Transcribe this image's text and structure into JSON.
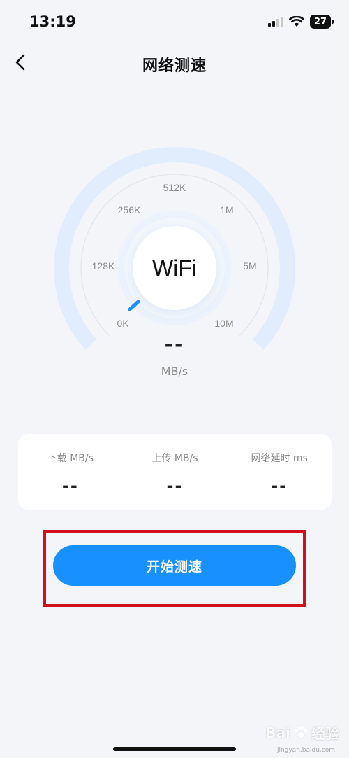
{
  "status_bar": {
    "time": "13:19",
    "battery": "27",
    "icons": [
      "cellular-signal-icon",
      "wifi-icon",
      "battery-icon"
    ]
  },
  "nav": {
    "title": "网络测速",
    "back_icon": "chevron-left-icon"
  },
  "gauge": {
    "center_label": "WiFi",
    "ticks": [
      "0K",
      "128K",
      "256K",
      "512K",
      "1M",
      "5M",
      "10M"
    ],
    "speed_value": "--",
    "speed_unit": "MB/s",
    "needle_level": 0
  },
  "stats": [
    {
      "label": "下载 MB/s",
      "value": "--"
    },
    {
      "label": "上传 MB/s",
      "value": "--"
    },
    {
      "label": "网络延时 ms",
      "value": "--"
    }
  ],
  "start_button": {
    "label": "开始测速"
  },
  "watermark": {
    "text": "Bai",
    "text2": "经验",
    "sub": "jingyan.baidu.com"
  },
  "colors": {
    "accent": "#1890ff",
    "highlight": "#d0111b",
    "background": "#f3f5f9"
  }
}
